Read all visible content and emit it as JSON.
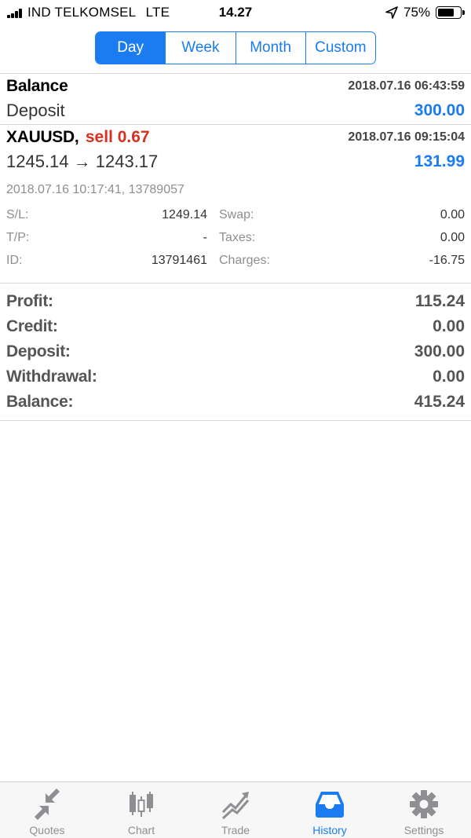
{
  "status_bar": {
    "carrier": "IND TELKOMSEL",
    "network": "LTE",
    "time": "14.27",
    "battery": "75%",
    "battery_level": 0.75
  },
  "period_tabs": [
    {
      "label": "Day",
      "active": true
    },
    {
      "label": "Week",
      "active": false
    },
    {
      "label": "Month",
      "active": false
    },
    {
      "label": "Custom",
      "active": false
    }
  ],
  "deposit_entry": {
    "title": "Balance",
    "timestamp": "2018.07.16 06:43:59",
    "type": "Deposit",
    "amount": "300.00"
  },
  "trade_entry": {
    "symbol": "XAUUSD,",
    "side": "sell 0.67",
    "close_time": "2018.07.16 09:15:04",
    "prices": "1245.14 → 1243.17",
    "profit": "131.99",
    "open_info": "2018.07.16 10:17:41, 13789057",
    "details": {
      "sl_label": "S/L:",
      "sl_value": "1249.14",
      "tp_label": "T/P:",
      "tp_value": "-",
      "id_label": "ID:",
      "id_value": "13791461",
      "swap_label": "Swap:",
      "swap_value": "0.00",
      "taxes_label": "Taxes:",
      "taxes_value": "0.00",
      "charges_label": "Charges:",
      "charges_value": "-16.75"
    }
  },
  "summary": [
    {
      "label": "Profit:",
      "value": "115.24"
    },
    {
      "label": "Credit:",
      "value": "0.00"
    },
    {
      "label": "Deposit:",
      "value": "300.00"
    },
    {
      "label": "Withdrawal:",
      "value": "0.00"
    },
    {
      "label": "Balance:",
      "value": "415.24"
    }
  ],
  "tab_bar": [
    {
      "label": "Quotes",
      "icon": "quotes-icon",
      "active": false
    },
    {
      "label": "Chart",
      "icon": "chart-icon",
      "active": false
    },
    {
      "label": "Trade",
      "icon": "trade-icon",
      "active": false
    },
    {
      "label": "History",
      "icon": "history-icon",
      "active": true
    },
    {
      "label": "Settings",
      "icon": "settings-icon",
      "active": false
    }
  ],
  "colors": {
    "accent": "#1a7cf0",
    "sell": "#d8301f",
    "inactive": "#8e8e93"
  }
}
